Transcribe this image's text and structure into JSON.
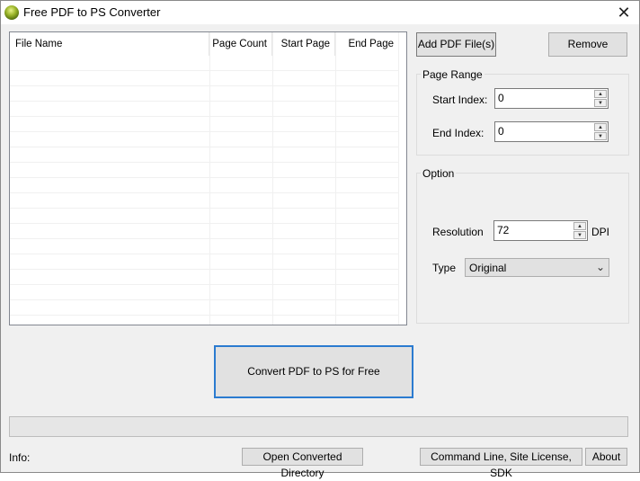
{
  "window": {
    "title": "Free PDF to PS Converter",
    "close_symbol": "✕"
  },
  "file_list": {
    "columns": [
      "File Name",
      "Page Count",
      "Start Page",
      "End Page"
    ],
    "rows": []
  },
  "buttons": {
    "add_pdf": "Add PDF File(s)",
    "remove": "Remove",
    "convert": "Convert PDF to PS for Free",
    "open_dir": "Open Converted Directory",
    "cmd_line": "Command Line, Site License, SDK",
    "about": "About"
  },
  "page_range": {
    "label": "Page Range",
    "start_label": "Start Index:",
    "start_value": "0",
    "end_label": "End Index:",
    "end_value": "0"
  },
  "option": {
    "label": "Option",
    "resolution_label": "Resolution",
    "resolution_value": "72",
    "dpi_label": "DPI",
    "type_label": "Type",
    "type_value": "Original"
  },
  "progress": {
    "fraction": 0
  },
  "info": {
    "label": "Info:"
  },
  "icons": {
    "app": "app-logo-icon",
    "close": "close-icon",
    "spin_up": "spin-up-icon",
    "spin_down": "spin-down-icon",
    "dropdown": "chevron-down-icon"
  },
  "colors": {
    "accent": "#2b7bd0",
    "progress": "#06b025",
    "window_bg": "#f0f0f0"
  }
}
